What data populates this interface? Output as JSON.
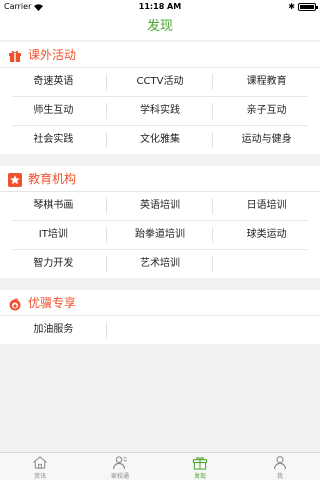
{
  "status_bar": {
    "carrier": "Carrier",
    "time": "11:18 AM"
  },
  "nav": {
    "title": "发现"
  },
  "sections": [
    {
      "title": "课外活动",
      "icon": "gift-icon",
      "color": "#f0522e",
      "items": [
        "奇速英语",
        "CCTV活动",
        "课程教育",
        "师生互动",
        "学科实践",
        "亲子互动",
        "社会实践",
        "文化雅集",
        "运动与健身"
      ]
    },
    {
      "title": "教育机构",
      "icon": "star-icon",
      "color": "#f0522e",
      "items": [
        "琴棋书画",
        "英语培训",
        "日语培训",
        "IT培训",
        "跆拳道培训",
        "球类运动",
        "智力开发",
        "艺术培训"
      ]
    },
    {
      "title": "优骥专享",
      "icon": "fire-icon",
      "color": "#f0522e",
      "items": [
        "加油服务"
      ]
    }
  ],
  "tabs": [
    {
      "label": "资讯",
      "icon": "home-icon",
      "active": false
    },
    {
      "label": "家校通",
      "icon": "contacts-icon",
      "active": false
    },
    {
      "label": "发现",
      "icon": "gift-icon",
      "active": true
    },
    {
      "label": "我",
      "icon": "person-icon",
      "active": false
    }
  ],
  "colors": {
    "accent": "#4aa52e",
    "section_title": "#f0522e",
    "background": "#f2f2f2"
  }
}
